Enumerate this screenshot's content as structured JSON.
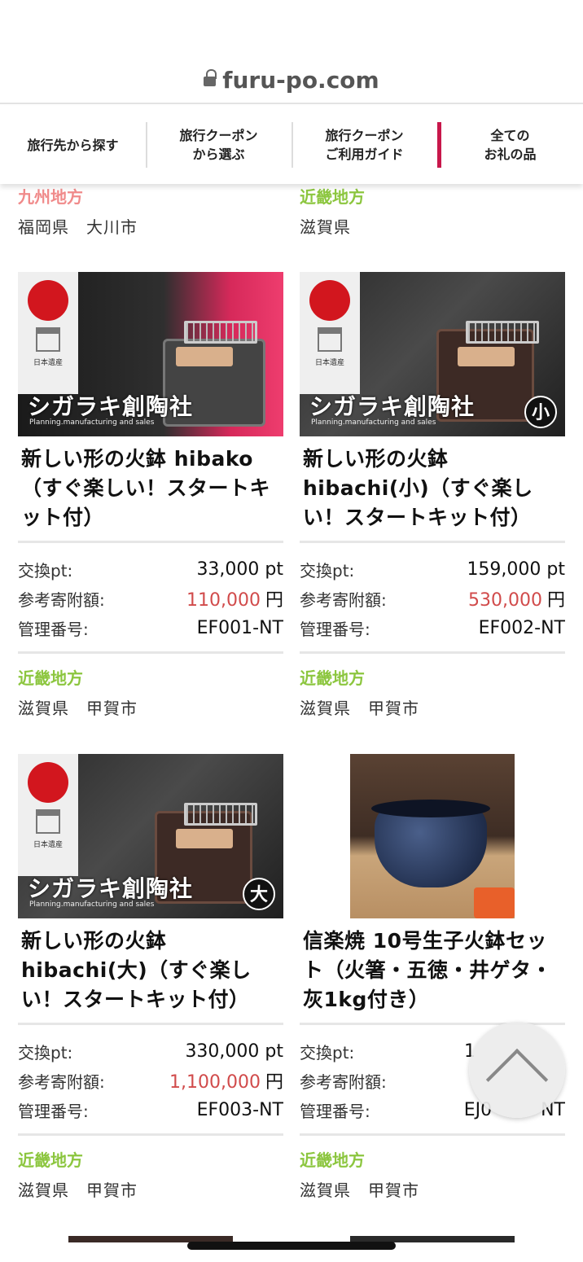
{
  "browser": {
    "url": "furu-po.com"
  },
  "nav": [
    {
      "label": "旅行先から探す"
    },
    {
      "label": "旅行クーポン\nから選ぶ"
    },
    {
      "label": "旅行クーポン\nご利用ガイド"
    },
    {
      "label": "全ての\nお礼の品"
    }
  ],
  "top_partial": [
    {
      "region": "九州地方",
      "place": "福岡県　大川市"
    },
    {
      "region": "近畿地方",
      "place": "滋賀県"
    }
  ],
  "labels": {
    "pt": "交換pt:",
    "donation": "参考寄附額:",
    "code": "管理番号:",
    "yen": "円"
  },
  "products": [
    {
      "title": "新しい形の火鉢 hibako（すぐ楽しい！スタートキット付）",
      "pt": "33,000 pt",
      "donation": "110,000",
      "code": "EF001-NT",
      "region": "近畿地方",
      "place": "滋賀県　甲賀市",
      "brand": "シガラキ創陶社",
      "brand_sub": "Planning.manufacturing and sales",
      "emblem_caption": "日本遺産",
      "size_tag": ""
    },
    {
      "title": "新しい形の火鉢 hibachi(小)（すぐ楽しい！スタートキット付）",
      "pt": "159,000 pt",
      "donation": "530,000",
      "code": "EF002-NT",
      "region": "近畿地方",
      "place": "滋賀県　甲賀市",
      "brand": "シガラキ創陶社",
      "brand_sub": "Planning.manufacturing and sales",
      "emblem_caption": "日本遺産",
      "size_tag": "小"
    },
    {
      "title": "新しい形の火鉢 hibachi(大)（すぐ楽しい！スタートキット付）",
      "pt": "330,000 pt",
      "donation": "1,100,000",
      "code": "EF003-NT",
      "region": "近畿地方",
      "place": "滋賀県　甲賀市",
      "brand": "シガラキ創陶社",
      "brand_sub": "Planning.manufacturing and sales",
      "emblem_caption": "日本遺産",
      "size_tag": "大"
    },
    {
      "title": "信楽焼 10号生子火鉢セット（火箸・五徳・井ゲタ・灰1kg付き）",
      "pt": "1",
      "donation": "",
      "code": "EJ0",
      "code_tail": "NT",
      "region": "近畿地方",
      "place": "滋賀県　甲賀市"
    }
  ],
  "colors": {
    "region_green": "#8cc63f",
    "region_pink": "#f08a8a",
    "price_red": "#d14b4b",
    "nav_accent": "#c8174b"
  }
}
